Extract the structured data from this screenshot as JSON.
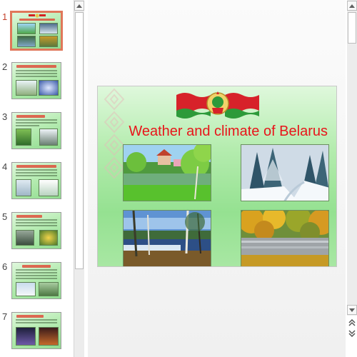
{
  "thumbnails": [
    {
      "number": "1",
      "active": true
    },
    {
      "number": "2",
      "active": false
    },
    {
      "number": "3",
      "active": false
    },
    {
      "number": "4",
      "active": false
    },
    {
      "number": "5",
      "active": false
    },
    {
      "number": "6",
      "active": false
    },
    {
      "number": "7",
      "active": false
    }
  ],
  "slide": {
    "title": "Weather and climate of Belarus",
    "photos": [
      "summer-lake-photo",
      "winter-forest-photo",
      "spring-lake-photo",
      "autumn-forest-photo"
    ]
  },
  "colors": {
    "title": "#e8151a",
    "slide_green": "#95e191",
    "active_thumb_border": "#e0775a"
  },
  "icons": [
    "scroll-up-icon",
    "scroll-down-icon",
    "previous-slide-icon",
    "next-slide-icon"
  ]
}
